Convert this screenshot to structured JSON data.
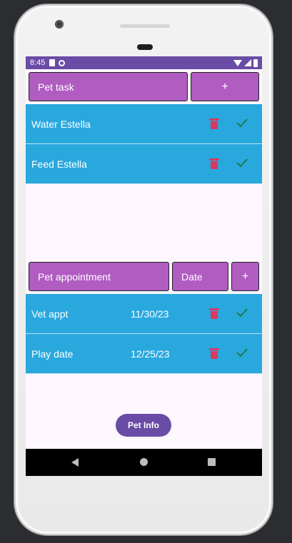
{
  "status_bar": {
    "time": "8:45"
  },
  "tasks": {
    "input_placeholder": "Pet task",
    "add_label": "+",
    "items": [
      {
        "label": "Water Estella"
      },
      {
        "label": "Feed Estella"
      }
    ]
  },
  "appointments": {
    "input_placeholder": "Pet appointment",
    "date_placeholder": "Date",
    "add_label": "+",
    "items": [
      {
        "label": "Vet appt",
        "date": "11/30/23"
      },
      {
        "label": "Play date",
        "date": "12/25/23"
      }
    ]
  },
  "pet_info_label": "Pet Info",
  "icons": {
    "delete": "trash-icon",
    "done": "check-icon"
  },
  "colors": {
    "status_bar": "#6a4ba5",
    "input_bg": "#b05cc1",
    "list_bg": "#29a8de",
    "delete_icon": "#d73a63",
    "check_icon": "#1f7a4a"
  }
}
